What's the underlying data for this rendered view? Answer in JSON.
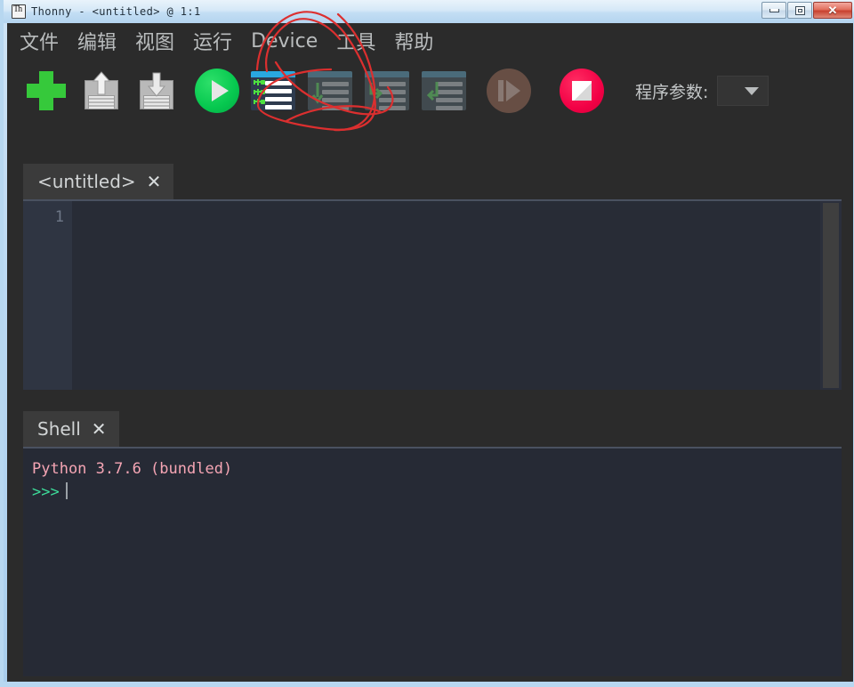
{
  "window": {
    "title": "Thonny  -  <untitled>  @  1:1",
    "app_icon": "thonny-icon",
    "controls": {
      "minimize": "–",
      "maximize": "□",
      "close": "✕"
    }
  },
  "menubar": {
    "items": [
      {
        "label": "文件",
        "name": "menu-file"
      },
      {
        "label": "编辑",
        "name": "menu-edit"
      },
      {
        "label": "视图",
        "name": "menu-view"
      },
      {
        "label": "运行",
        "name": "menu-run"
      },
      {
        "label": "Device",
        "name": "menu-device"
      },
      {
        "label": "工具",
        "name": "menu-tools"
      },
      {
        "label": "帮助",
        "name": "menu-help"
      }
    ]
  },
  "toolbar": {
    "buttons": [
      {
        "name": "new-file-button",
        "icon": "plus-icon",
        "enabled": true
      },
      {
        "name": "load-file-button",
        "icon": "floppy-up-icon",
        "enabled": true
      },
      {
        "name": "save-file-button",
        "icon": "floppy-down-icon",
        "enabled": true
      },
      {
        "name": "run-button",
        "icon": "play-circle-icon",
        "enabled": true
      },
      {
        "name": "debug-button",
        "icon": "debug-bug-icon",
        "enabled": true
      },
      {
        "name": "step-over-button",
        "icon": "step-over-icon",
        "enabled": false
      },
      {
        "name": "step-into-button",
        "icon": "step-into-icon",
        "enabled": false
      },
      {
        "name": "step-out-button",
        "icon": "step-out-icon",
        "enabled": false
      },
      {
        "name": "resume-button",
        "icon": "resume-circle-icon",
        "enabled": false
      },
      {
        "name": "stop-button",
        "icon": "stop-circle-icon",
        "enabled": true
      }
    ],
    "args_label": "程序参数:",
    "args_value": "",
    "args_caret": "caret-down-icon"
  },
  "editor": {
    "tab_label": "<untitled>",
    "tab_close": "✕",
    "line_number": "1",
    "content": ""
  },
  "shell": {
    "tab_label": "Shell",
    "tab_close": "✕",
    "banner": "Python 3.7.6 (bundled)",
    "prompt": ">>>",
    "input": ""
  },
  "annotation": {
    "name": "red-circle-annotation",
    "color": "#e03030",
    "target": "debug-button"
  },
  "colors": {
    "app_bg": "#2b2b2b",
    "editor_bg": "#282c36",
    "shell_bg": "#262a35",
    "accent_green": "#36c93b",
    "accent_red": "#f20045",
    "frame_blue": "#b7d7f0",
    "banner_pink": "#f5a5b4",
    "prompt_green": "#3ddc9a"
  }
}
